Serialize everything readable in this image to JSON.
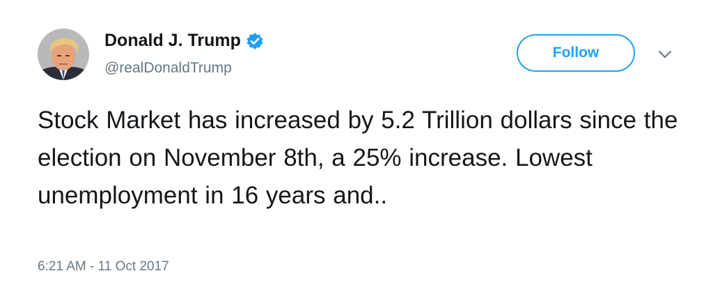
{
  "author": {
    "display_name": "Donald J. Trump",
    "handle": "@realDonaldTrump",
    "verified": true,
    "avatar_icon": "profile-photo"
  },
  "actions": {
    "follow_label": "Follow",
    "more_icon": "chevron-down-icon"
  },
  "tweet": {
    "text": "Stock Market has increased by 5.2 Trillion dollars since the election on November 8th, a 25% increase. Lowest unemployment in 16 years and..",
    "timestamp": "6:21 AM - 11 Oct 2017"
  },
  "colors": {
    "accent": "#1da1f2",
    "text_primary": "#14171a",
    "text_secondary": "#657786"
  }
}
